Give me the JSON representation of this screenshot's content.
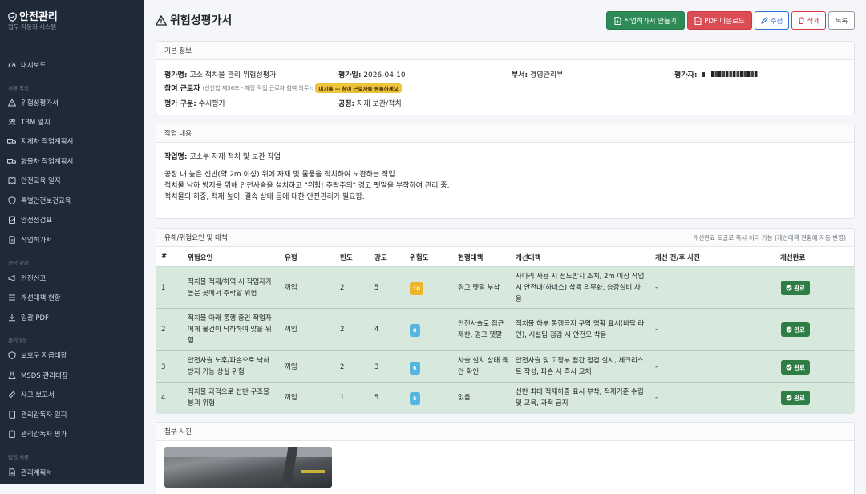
{
  "brand": {
    "title": "안전관리",
    "subtitle": "업무 자동화 시스템"
  },
  "nav": {
    "dashboard": "대시보드",
    "sec_write": "서류 작성",
    "risk": "위험성평가서",
    "tbm": "TBM 일지",
    "forklift": "지게차 작업계획서",
    "cargo": "화물차 작업계획서",
    "edu": "안전교육 일지",
    "special_edu": "특별안전보건교육",
    "checklist": "안전점검표",
    "permit": "작업허가서",
    "sec_site": "현장 관리",
    "report": "안전신고",
    "improve": "개선대책 현황",
    "bulk_pdf": "일괄 PDF",
    "sec_manage": "관리대장",
    "ppe": "보호구 지급대장",
    "msds": "MSDS 관리대장",
    "accident": "사고 보고서",
    "supervisor_log": "관리감독자 일지",
    "supervisor_eval": "관리감독자 평가",
    "sec_law": "법정 서류",
    "mgmt_plan": "관리계획서"
  },
  "page": {
    "title": "위험성평가서"
  },
  "buttons": {
    "permit": "작업허가서 만들기",
    "pdf": "PDF 다운로드",
    "edit": "수정",
    "delete": "삭제",
    "list": "목록"
  },
  "basic": {
    "header": "기본 정보",
    "name_label": "평가명:",
    "name": "고소 적치물 관리 위험성평가",
    "date_label": "평가일:",
    "date": "2026-04-10",
    "dept_label": "부서:",
    "dept": "경영관리부",
    "assessor_label": "평가자:",
    "workers_label": "참여 근로자",
    "workers_note": "(산안법 제36조 - 해당 작업 근로자 참여 의무):",
    "workers_badge": "미기록 — 참여 근로자를 등록하세요",
    "type_label": "평가 구분:",
    "type": "수시평가",
    "process_label": "공정:",
    "process": "자재 보관/적치"
  },
  "work": {
    "header": "작업 내용",
    "name_label": "작업명:",
    "name": "고소부 자재 적치 및 보관 작업",
    "lines": [
      "공장 내 높은 선반(약 2m 이상) 위에 자재 및 물품을 적치하여 보관하는 작업.",
      "적치물 낙하 방지를 위해 안전사슬을 설치하고 \"위험! 추락주의\" 경고 펫말을 부착하여 관리 중.",
      "적치물의 하중, 적재 높이, 결속 상태 등에 대한 안전관리가 필요함."
    ]
  },
  "hazards": {
    "header": "유해/위험요인 및 대책",
    "note": "개선완료 토글로 즉시 처리 가능 (개선대책 현황에 자동 반영)",
    "columns": [
      "#",
      "위험요인",
      "유형",
      "빈도",
      "강도",
      "위험도",
      "현행대책",
      "개선대책",
      "개선 전/후 사진",
      "개선완료"
    ],
    "rows": [
      {
        "no": "1",
        "factor": "적치물 적재/하역 시 작업자가 높은 곳에서 추락할 위험",
        "type": "끼임",
        "freq": "2",
        "sev": "5",
        "risk": "10",
        "risk_color": "#f0b429",
        "current": "경고 펫말 부착",
        "improve": "사다리 사용 시 전도방지 조치, 2m 이상 작업 시 안전대(하네스) 착용 의무화, 승강설비 사용",
        "photo": "-",
        "done": "완료"
      },
      {
        "no": "2",
        "factor": "적치물 아래 통행 중인 작업자에게 물건이 낙하하여 맞을 위험",
        "type": "끼임",
        "freq": "2",
        "sev": "4",
        "risk": "8",
        "risk_color": "#56b6e0",
        "current": "안전사슬로 접근 제한, 경고 펫말",
        "improve": "적치물 하부 통행금지 구역 명확 표시(바닥 라인), 시설팀 점검 시 안전모 착용",
        "photo": "-",
        "done": "완료"
      },
      {
        "no": "3",
        "factor": "안전사슬 노후/파손으로 낙하 방지 기능 상실 위험",
        "type": "끼임",
        "freq": "2",
        "sev": "3",
        "risk": "6",
        "risk_color": "#56b6e0",
        "current": "사슬 설치 상태 육안 확인",
        "improve": "안전사슬 및 고정부 월간 점검 실시, 체크리스트 작성, 파손 시 즉시 교체",
        "photo": "-",
        "done": "완료"
      },
      {
        "no": "4",
        "factor": "적치물 과적으로 선반 구조물 붕괴 위험",
        "type": "끼임",
        "freq": "1",
        "sev": "5",
        "risk": "5",
        "risk_color": "#56b6e0",
        "current": "없음",
        "improve": "선반 최대 적재하중 표시 부착, 적재기준 수립 및 교육, 과적 금지",
        "photo": "-",
        "done": "완료"
      }
    ]
  },
  "photos": {
    "header": "첨부 사진"
  }
}
